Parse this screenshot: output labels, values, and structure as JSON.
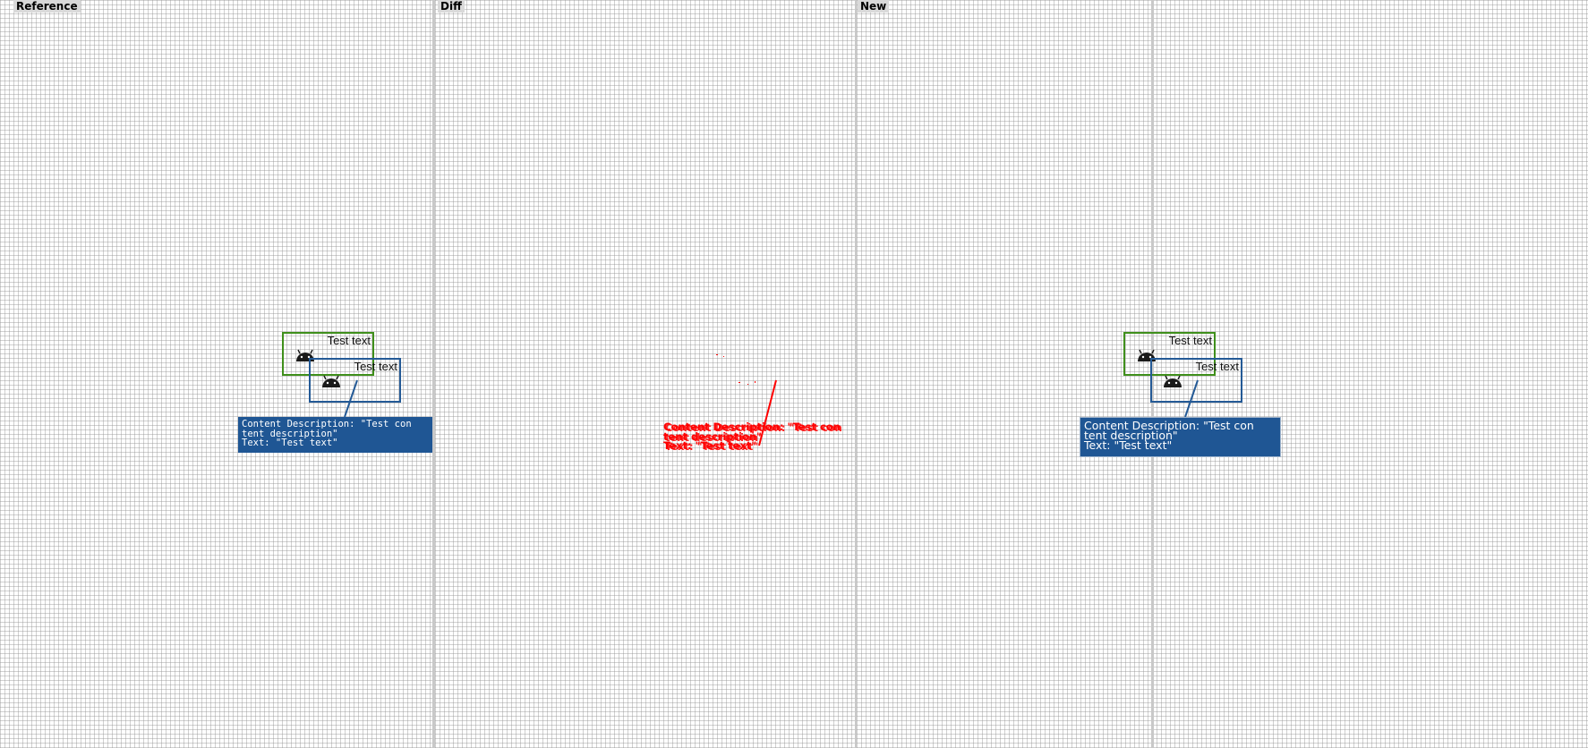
{
  "panels": {
    "reference": "Reference",
    "diff": "Diff",
    "new": "New"
  },
  "reference": {
    "green_box_text": "Test text",
    "blue_box_text": "Test text",
    "tooltip": "Content Description: \"Test con\ntent description\"\nText: \"Test text\""
  },
  "diff": {
    "tooltip": "Content Description: \"Test con\ntent description\"\nText: \"Test text\""
  },
  "new": {
    "green_box_text": "Test text",
    "blue_box_text": "Test text",
    "tooltip": "Content Description: \"Test con\ntent description\"\nText: \"Test text\""
  },
  "colors": {
    "green_box": "#3f8f1b",
    "blue_box": "#245a96",
    "tooltip_bg": "#1f5694",
    "diff": "#ff0000"
  },
  "icons": [
    "android-icon"
  ]
}
